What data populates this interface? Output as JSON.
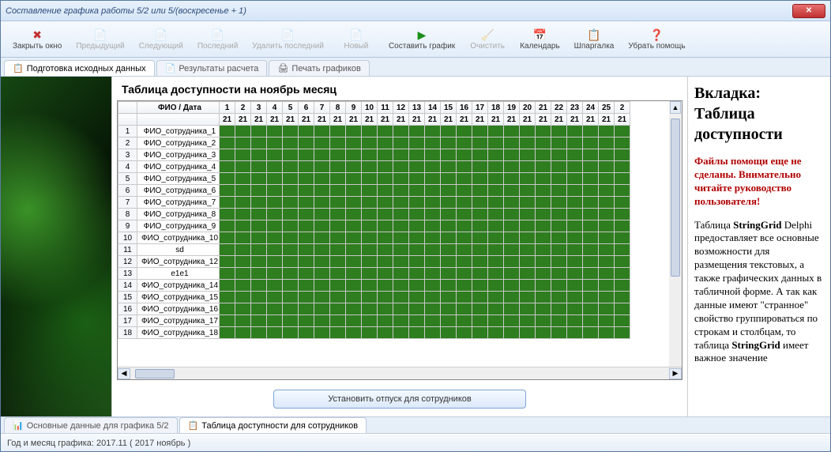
{
  "window": {
    "title": "Составление графика работы 5/2 или 5/(воскресенье + 1)"
  },
  "toolbar": [
    {
      "name": "close-window",
      "label": "Закрыть окно",
      "icon": "✖",
      "enabled": true,
      "icon_color": "#c03030"
    },
    {
      "name": "prev",
      "label": "Предыдущий",
      "icon": "📄",
      "enabled": false
    },
    {
      "name": "next",
      "label": "Следующий",
      "icon": "📄",
      "enabled": false
    },
    {
      "name": "last",
      "label": "Последний",
      "icon": "📄",
      "enabled": false
    },
    {
      "name": "delete-last",
      "label": "Удалить последний",
      "icon": "📄",
      "enabled": false
    },
    {
      "name": "new",
      "label": "Новый",
      "icon": "📄",
      "enabled": false
    },
    {
      "name": "compose",
      "label": "Составить график",
      "icon": "▶",
      "enabled": true,
      "icon_color": "#1a8f1a"
    },
    {
      "name": "clear",
      "label": "Очистить",
      "icon": "🧹",
      "enabled": false
    },
    {
      "name": "calendar",
      "label": "Календарь",
      "icon": "📅",
      "enabled": true,
      "icon_color": "#2060c0"
    },
    {
      "name": "cheat",
      "label": "Шпаргалка",
      "icon": "📋",
      "enabled": true,
      "icon_color": "#b07000"
    },
    {
      "name": "hide-help",
      "label": "Убрать помощь",
      "icon": "❓",
      "enabled": true,
      "icon_color": "#2060c0"
    }
  ],
  "tabs_top": [
    {
      "name": "tab-source",
      "label": "Подготовка исходных данных",
      "icon": "📋",
      "active": true
    },
    {
      "name": "tab-results",
      "label": "Результаты расчета",
      "icon": "📄",
      "active": false
    },
    {
      "name": "tab-print",
      "label": "Печать графиков",
      "icon": "🖨",
      "active": false
    }
  ],
  "main": {
    "title": "Таблица доступности на ноябрь месяц",
    "fio_header": "ФИО / Дата",
    "days": [
      1,
      2,
      3,
      4,
      5,
      6,
      7,
      8,
      9,
      10,
      11,
      12,
      13,
      14,
      15,
      16,
      17,
      18,
      19,
      20,
      21,
      22,
      23,
      24,
      25,
      2
    ],
    "day_value": "21",
    "rows": [
      {
        "n": 1,
        "name": "ФИО_сотрудника_1"
      },
      {
        "n": 2,
        "name": "ФИО_сотрудника_2"
      },
      {
        "n": 3,
        "name": "ФИО_сотрудника_3"
      },
      {
        "n": 4,
        "name": "ФИО_сотрудника_4"
      },
      {
        "n": 5,
        "name": "ФИО_сотрудника_5"
      },
      {
        "n": 6,
        "name": "ФИО_сотрудника_6"
      },
      {
        "n": 7,
        "name": "ФИО_сотрудника_7"
      },
      {
        "n": 8,
        "name": "ФИО_сотрудника_8"
      },
      {
        "n": 9,
        "name": "ФИО_сотрудника_9"
      },
      {
        "n": 10,
        "name": "ФИО_сотрудника_10"
      },
      {
        "n": 11,
        "name": "sd"
      },
      {
        "n": 12,
        "name": "ФИО_сотрудника_12"
      },
      {
        "n": 13,
        "name": "e1e1"
      },
      {
        "n": 14,
        "name": "ФИО_сотрудника_14"
      },
      {
        "n": 15,
        "name": "ФИО_сотрудника_15"
      },
      {
        "n": 16,
        "name": "ФИО_сотрудника_16"
      },
      {
        "n": 17,
        "name": "ФИО_сотрудника_17"
      },
      {
        "n": 18,
        "name": "ФИО_сотрудника_18"
      }
    ],
    "action_button": "Установить отпуск для сотрудников"
  },
  "help": {
    "title": "Вкладка: Таблица доступности",
    "warning": "Файлы помощи еще не сделаны. Внимательно читайте руководство пользователя!",
    "body_parts": [
      "Таблица ",
      "StringGrid",
      " Delphi предоставляет все основные возможности для размещения текстовых, а также графических данных в табличной форме. А так как данные имеют \"странное\" свойство группироваться по строкам и столбцам, то таблица ",
      "StringGrid",
      " имеет важное значение"
    ]
  },
  "tabs_bottom": [
    {
      "name": "btab-main",
      "label": "Основные данные для графика 5/2",
      "icon": "📊",
      "active": false
    },
    {
      "name": "btab-avail",
      "label": "Таблица доступности для сотрудников",
      "icon": "📋",
      "active": true
    }
  ],
  "status": {
    "text": "Год и месяц графика:  2017.11  ( 2017  ноябрь )"
  }
}
